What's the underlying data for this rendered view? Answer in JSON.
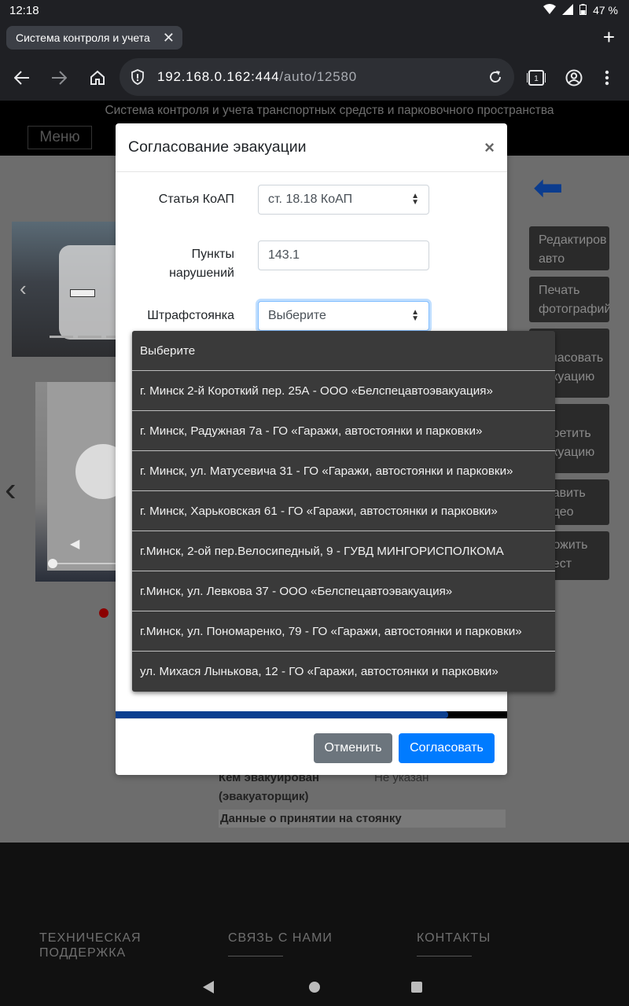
{
  "status": {
    "time": "12:18",
    "battery": "47 %"
  },
  "browser": {
    "tab_title": "Система контроля и учета",
    "url_host": "192.168.0.162:444",
    "url_path": "/auto/12580"
  },
  "site": {
    "title": "Система контроля и учета транспортных средств и парковочного пространства",
    "menu_label": "Меню"
  },
  "side_buttons": [
    {
      "line1": "Редактиров",
      "line2": "авто"
    },
    {
      "line1": "Печать",
      "line2": "фотографий"
    },
    {
      "line1": "огласовать",
      "line2": "вакуацию"
    },
    {
      "line1": "апретить",
      "line2": "вакуацию"
    },
    {
      "line1": "обавить",
      "line2": "видео"
    },
    {
      "line1": "аложить",
      "line2": "арест"
    }
  ],
  "info": {
    "evacuated_by_label": "Кем эвакуирован (эвакуаторщик)",
    "evacuated_by_value": "Не указан",
    "parking_header": "Данные о принятии на стоянку"
  },
  "footer": {
    "col1": "ТЕХНИЧЕСКАЯ ПОДДЕРЖКА",
    "col2": "СВЯЗЬ С НАМИ",
    "col3": "КОНТАКТЫ"
  },
  "modal": {
    "title": "Согласование эвакуации",
    "close": "×",
    "article_label": "Статья КоАП",
    "article_value": "ст. 18.18 КоАП",
    "points_label": "Пункты нарушений",
    "points_value": "143.1",
    "lot_label": "Штрафстоянка",
    "lot_value": "Выберите",
    "progress": 0.85,
    "cancel_label": "Отменить",
    "ok_label": "Согласовать"
  },
  "dropdown_options": [
    "Выберите",
    "г. Минск 2-й Короткий пер. 25А - ООО «Белспецавтоэвакуация»",
    "г. Минск, Радужная 7а - ГО «Гаражи, автостоянки и парковки»",
    "г. Минск, ул. Матусевича 31 - ГО «Гаражи, автостоянки и парковки»",
    "г. Минск, Харьковская 61 - ГО «Гаражи, автостоянки и парковки»",
    "г.Минск, 2-ой пер.Велосипедный, 9 - ГУВД МИНГОРИСПОЛКОМА",
    "г.Минск, ул. Левкова 37 - ООО «Белспецавтоэвакуация»",
    "г.Минск, ул. Пономаренко, 79 - ГО «Гаражи, автостоянки и парковки»",
    "ул. Михася Лынькова, 12 - ГО «Гаражи, автостоянки и парковки»"
  ]
}
